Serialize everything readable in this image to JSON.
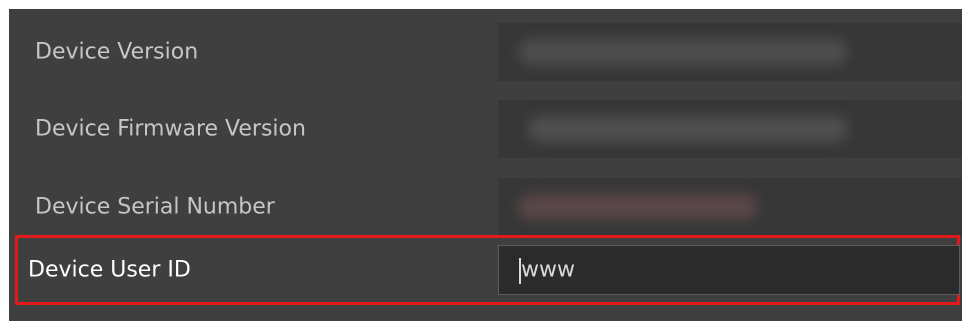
{
  "properties": [
    {
      "label": "Device Version",
      "value": ""
    },
    {
      "label": "Device Firmware Version",
      "value": ""
    },
    {
      "label": "Device Serial Number",
      "value": ""
    },
    {
      "label": "Device User ID",
      "value": "www"
    }
  ],
  "colors": {
    "panel_bg": "#3f3f3f",
    "value_bg": "#373737",
    "input_bg": "#2b2b2b",
    "highlight": "#e11b1b",
    "label": "#c6c6c6",
    "label_selected": "#ffffff"
  }
}
